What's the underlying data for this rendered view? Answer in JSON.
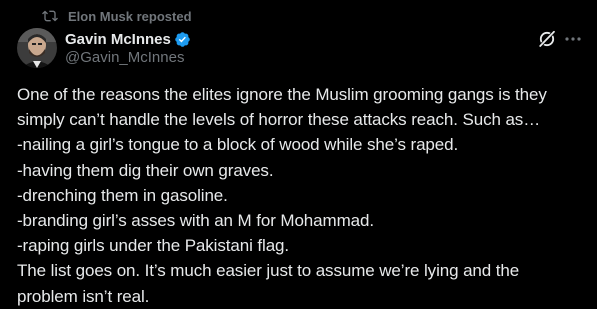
{
  "repost": {
    "icon": "repost-icon",
    "label": "Elon Musk reposted"
  },
  "author": {
    "display_name": "Gavin McInnes",
    "handle": "@Gavin_McInnes",
    "verified": true,
    "verified_color": "#1d9bf0"
  },
  "actions": {
    "grok_icon": "grok-icon",
    "more_icon": "more-icon"
  },
  "tweet": {
    "lines": [
      "One of the reasons the elites ignore the Muslim grooming gangs is they",
      "simply can’t handle the levels of horror these attacks reach. Such as…",
      "-nailing a girl’s tongue to a block of wood while she’s raped.",
      "-having them dig their own graves.",
      "-drenching them in gasoline.",
      "-branding girl’s asses with an M for Mohammad.",
      "-raping girls under the Pakistani flag.",
      "The list goes on. It’s much easier just to assume we’re lying and the",
      "problem isn’t real."
    ]
  },
  "colors": {
    "background": "#000000",
    "text": "#e7e9ea",
    "secondary": "#71767b"
  }
}
